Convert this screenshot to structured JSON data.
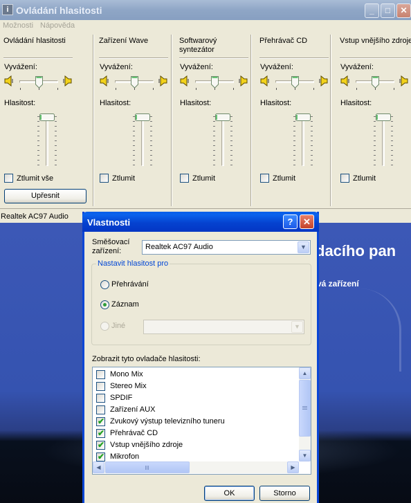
{
  "volume_window": {
    "title": "Ovládání hlasitosti",
    "menu": [
      "Možnosti",
      "Nápověda"
    ],
    "channels": [
      {
        "name": "Ovládání hlasitosti",
        "balance_label": "Vyvážení:",
        "volume_label": "Hlasitost:",
        "balance": 0.5,
        "volume": 1.0,
        "mute_label": "Ztlumit vše",
        "muted": false
      },
      {
        "name": "Zařízení Wave",
        "balance_label": "Vyvážení:",
        "volume_label": "Hlasitost:",
        "balance": 0.5,
        "volume": 1.0,
        "mute_label": "Ztlumit",
        "muted": false
      },
      {
        "name": "Softwarový syntezátor",
        "balance_label": "Vyvážení:",
        "volume_label": "Hlasitost:",
        "balance": 0.5,
        "volume": 1.0,
        "mute_label": "Ztlumit",
        "muted": false
      },
      {
        "name": "Přehrávač CD",
        "balance_label": "Vyvážení:",
        "volume_label": "Hlasitost:",
        "balance": 0.5,
        "volume": 1.0,
        "mute_label": "Ztlumit",
        "muted": false
      },
      {
        "name": "Vstup vnějšího zdroje",
        "balance_label": "Vyvážení:",
        "volume_label": "Hlasitost:",
        "balance": 0.5,
        "volume": 1.0,
        "mute_label": "Ztlumit",
        "muted": false
      }
    ],
    "advanced_button": "Upřesnit",
    "status": "Realtek AC97 Audio"
  },
  "desktop": {
    "heading_partial": "dacího pan",
    "sub_partial": "vá zařízení"
  },
  "dialog": {
    "title": "Vlastnosti",
    "help_glyph": "?",
    "close_glyph": "✕",
    "mixer_label": "Směšovací zařízení:",
    "mixer_value": "Realtek AC97 Audio",
    "group_title": "Nastavit hlasitost pro",
    "radio_playback": "Přehrávání",
    "radio_record": "Záznam",
    "radio_other": "Jiné",
    "selected_mode": "Záznam",
    "list_label": "Zobrazit tyto ovladače hlasitosti:",
    "controls": [
      {
        "label": "Mono Mix",
        "checked": false
      },
      {
        "label": "Stereo Mix",
        "checked": false
      },
      {
        "label": "SPDIF",
        "checked": false
      },
      {
        "label": "Zařízení AUX",
        "checked": false
      },
      {
        "label": "Zvukový výstup televizního tuneru",
        "checked": true
      },
      {
        "label": "Přehrávač CD",
        "checked": true
      },
      {
        "label": "Vstup vnějšího zdroje",
        "checked": true
      },
      {
        "label": "Mikrofon",
        "checked": true
      }
    ],
    "ok_label": "OK",
    "cancel_label": "Storno"
  }
}
